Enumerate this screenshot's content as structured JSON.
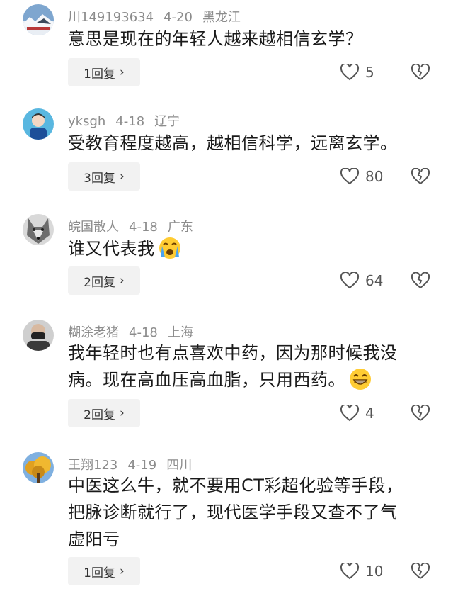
{
  "comments": [
    {
      "user": "川149193634",
      "date": "4-20",
      "location": "黑龙江",
      "text": "意思是现在的年轻人越来越相信玄学？",
      "reply_label": "1回复",
      "likes": "5",
      "avatar": "snowy-mountain-avatar"
    },
    {
      "user": "yksgh",
      "date": "4-18",
      "location": "辽宁",
      "text": "受教育程度越高，越相信科学，远离玄学。",
      "reply_label": "3回复",
      "likes": "80",
      "avatar": "child-avatar"
    },
    {
      "user": "皖国散人",
      "date": "4-18",
      "location": "广东",
      "text": "谁又代表我",
      "emoji": "crying-face-emoji",
      "reply_label": "2回复",
      "likes": "64",
      "avatar": "wolf-avatar"
    },
    {
      "user": "糊涂老猪",
      "date": "4-18",
      "location": "上海",
      "text_line1": "我年轻时也有点喜欢中药，因为那时候我没",
      "text_line2": "病。现在高血压高血脂，只用西药。",
      "emoji": "grinning-face-emoji",
      "reply_label": "2回复",
      "likes": "4",
      "avatar": "masked-man-avatar"
    },
    {
      "user": "王翔123",
      "date": "4-19",
      "location": "四川",
      "text_line1": "中医这么牛，就不要用CT彩超化验等手段，",
      "text_line2": "把脉诊断就行了，现代医学手段又查不了气",
      "text_line3": "虚阳亏",
      "reply_label": "1回复",
      "likes": "10",
      "avatar": "autumn-tree-avatar"
    }
  ],
  "colors": {
    "meta": "#8c8c8c",
    "reply_bg": "#f2f2f2",
    "text": "#1a1a1a"
  }
}
